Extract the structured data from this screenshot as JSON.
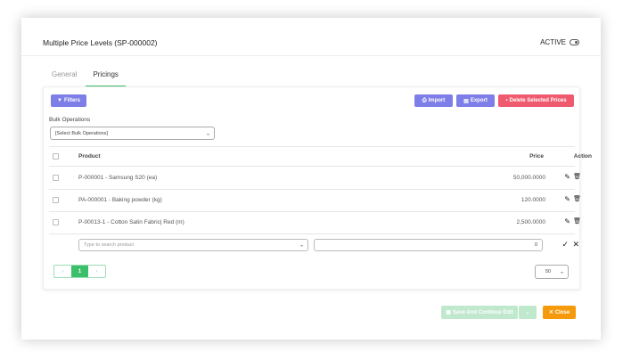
{
  "header": {
    "title": "Multiple Price Levels (SP-000002)",
    "status": "ACTIVE"
  },
  "tabs": [
    {
      "label": "General"
    },
    {
      "label": "Pricings"
    }
  ],
  "toolbar": {
    "filters_label": "Filters",
    "import_label": "Import",
    "export_label": "Export",
    "delete_label": "Delete Selected Prices"
  },
  "bulk": {
    "label": "Bulk Operations",
    "selected": "[Select Bulk Operations]"
  },
  "table": {
    "headers": {
      "product": "Product",
      "price": "Price",
      "action": "Action"
    },
    "rows": [
      {
        "product": "P-000001 - Samsung S20 (ea)",
        "price": "50,000.0000"
      },
      {
        "product": "PA-000001 - Baking powder (kg)",
        "price": "120.0000"
      },
      {
        "product": "P-00013-1 - Cotton Satin Fabric| Red (m)",
        "price": "2,500.0000"
      }
    ],
    "new_row": {
      "product_placeholder": "Type to search product",
      "price_value": "0"
    }
  },
  "pagination": {
    "prev": "‹",
    "current": "1",
    "next": "›",
    "page_size": "50"
  },
  "footer": {
    "save_label": "Save And Continue Edit",
    "close_label": "Close"
  },
  "colors": {
    "accent_green": "#3cbf6b",
    "purple": "#7e7ee8",
    "red": "#f05a6e",
    "orange": "#f59a0c"
  }
}
